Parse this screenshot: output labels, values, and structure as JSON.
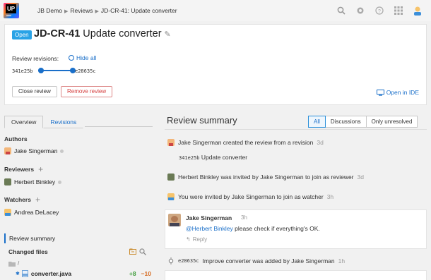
{
  "app": {
    "logo_text": "UP",
    "brand_colors": [
      "#ff318c",
      "#fc801d",
      "#087cfa",
      "#6b57ff"
    ]
  },
  "breadcrumb": [
    "JB Demo",
    "Reviews",
    "JD-CR-41: Update converter"
  ],
  "topbar_icons": [
    "search-icon",
    "settings-icon",
    "help-icon",
    "apps-grid-icon",
    "user-avatar-icon"
  ],
  "review": {
    "status": "Open",
    "id": "JD-CR-41",
    "title": "Update converter",
    "revisions_label": "Review revisions:",
    "hide_all": "Hide all",
    "revision_from": "341e25b",
    "revision_to": "e28635c",
    "close_button": "Close review",
    "remove_button": "Remove review",
    "open_ide": "Open in IDE"
  },
  "sidebar": {
    "tabs": [
      "Overview",
      "Revisions"
    ],
    "authors_label": "Authors",
    "authors": [
      "Jake Singerman"
    ],
    "reviewers_label": "Reviewers",
    "reviewers": [
      "Herbert Binkley"
    ],
    "watchers_label": "Watchers",
    "watchers": [
      "Andrea DeLacey"
    ],
    "nav_selected": "Review summary",
    "changed_files_label": "Changed files",
    "folder": "/",
    "file": {
      "name": "converter.java",
      "added": "+8",
      "removed": "−10"
    }
  },
  "summary": {
    "title": "Review summary",
    "filters": [
      "All",
      "Discussions",
      "Only unresolved"
    ],
    "active_filter": "All",
    "events": [
      {
        "text": "Jake Singerman created the review from a revision",
        "time": "3d"
      },
      {
        "text": "Herbert Binkley was invited by Jake Singerman to join as reviewer",
        "time": "3d"
      },
      {
        "text": "You were invited by Jake Singerman to join as watcher",
        "time": "3h"
      },
      {
        "commit": "e28635c",
        "text": "Improve converter was added by Jake Singerman",
        "time": "1h"
      }
    ],
    "first_commit": {
      "hash": "341e25b",
      "message": "Update converter"
    },
    "comment": {
      "author": "Jake Singerman",
      "time": "3h",
      "mention": "@Herbert Binkley",
      "text": "please check if everything's OK.",
      "reply": "Reply"
    }
  }
}
